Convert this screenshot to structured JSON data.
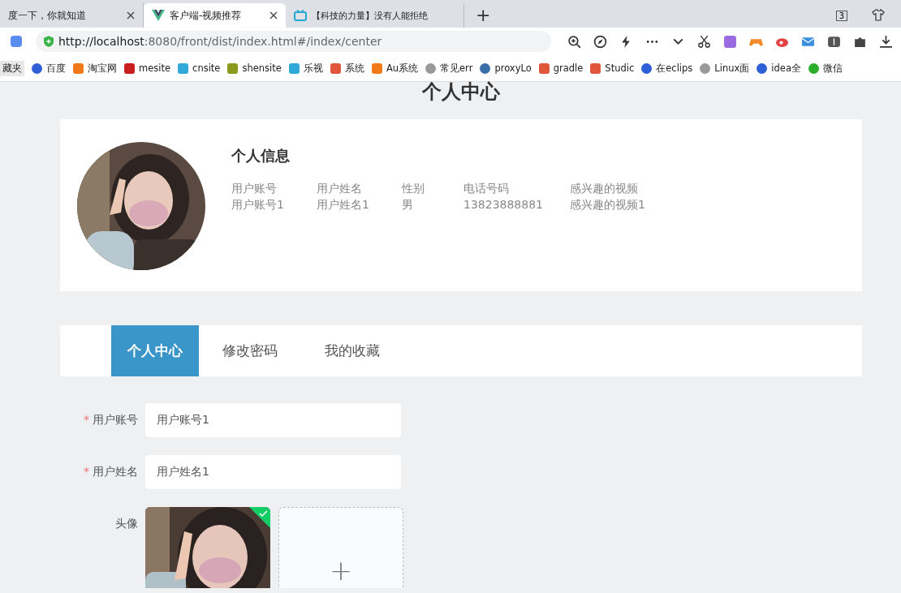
{
  "browser": {
    "tabs": [
      {
        "title": "度一下，你就知道",
        "selected": false
      },
      {
        "title": "客户端-视频推荐",
        "selected": true
      },
      {
        "title": "【科技的力量】没有人能拒绝",
        "selected": false
      }
    ],
    "new_tab": "+",
    "tab_count": "3",
    "url": {
      "host": "http://localhost",
      "rest": ":8080/front/dist/index.html#/index/center"
    },
    "bookmarks": [
      "藏夹",
      "百度",
      "淘宝网",
      "mesite",
      "cnsite",
      "shensite",
      "乐视",
      "系统",
      "Au系统",
      "常见err",
      "proxyLo",
      "gradle",
      "Studic",
      "在eclips",
      "Linux面",
      "idea全",
      "微信"
    ]
  },
  "page": {
    "title": "个人中心",
    "info": {
      "heading": "个人信息",
      "fields": [
        {
          "label": "用户账号",
          "value": "用户账号1"
        },
        {
          "label": "用户姓名",
          "value": "用户姓名1"
        },
        {
          "label": "性别",
          "value": "男"
        },
        {
          "label": "电话号码",
          "value": "13823888881"
        },
        {
          "label": "感兴趣的视频",
          "value": "感兴趣的视频1"
        }
      ]
    },
    "tabs": [
      {
        "label": "个人中心",
        "selected": true
      },
      {
        "label": "修改密码",
        "selected": false
      },
      {
        "label": "我的收藏",
        "selected": false
      }
    ],
    "form": [
      {
        "label": "用户账号",
        "mark": "*",
        "value": "用户账号1"
      },
      {
        "label": "用户姓名",
        "mark": "*",
        "value": "用户姓名1"
      }
    ],
    "upload": {
      "label": "头像",
      "uploaded": true,
      "add": "+"
    }
  }
}
